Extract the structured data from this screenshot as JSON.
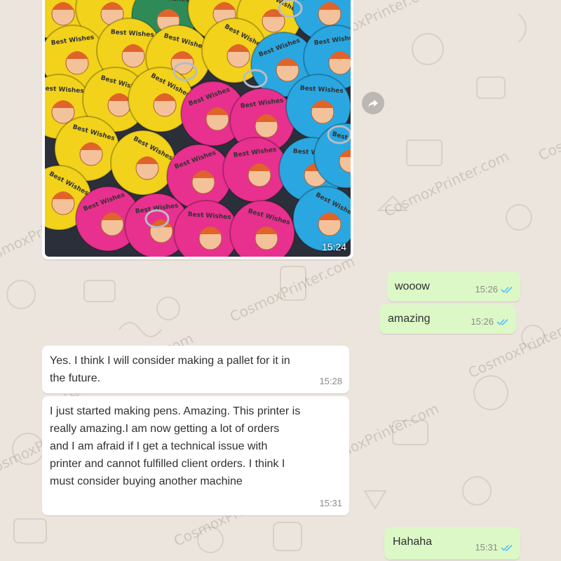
{
  "watermark": {
    "text": "CosmoxPrinter.com"
  },
  "photo_message": {
    "time": "15:24",
    "disc_caption": "Best Wishes"
  },
  "messages": [
    {
      "side": "out",
      "text": "wooow",
      "time": "15:26"
    },
    {
      "side": "out",
      "text": "amazing",
      "time": "15:26"
    },
    {
      "side": "in",
      "text": "Yes. I think I will consider making a pallet for it in\nthe future.",
      "time": "15:28"
    },
    {
      "side": "in",
      "text": "I just started making pens. Amazing. This printer is\nreally amazing.I am now getting a lot of orders\nand I am afraid if I get a technical issue with\nprinter and cannot fulfilled client orders. I think I\nmust consider buying another machine",
      "time": "15:31"
    },
    {
      "side": "out",
      "text": "Hahaha",
      "time": "15:31"
    }
  ],
  "icons": {
    "read_receipt": "double-check-icon",
    "forward": "forward-icon"
  },
  "colors": {
    "background": "#ece5dd",
    "outgoing": "#dcf8c6",
    "incoming": "#ffffff",
    "tick": "#4fc3f7"
  }
}
